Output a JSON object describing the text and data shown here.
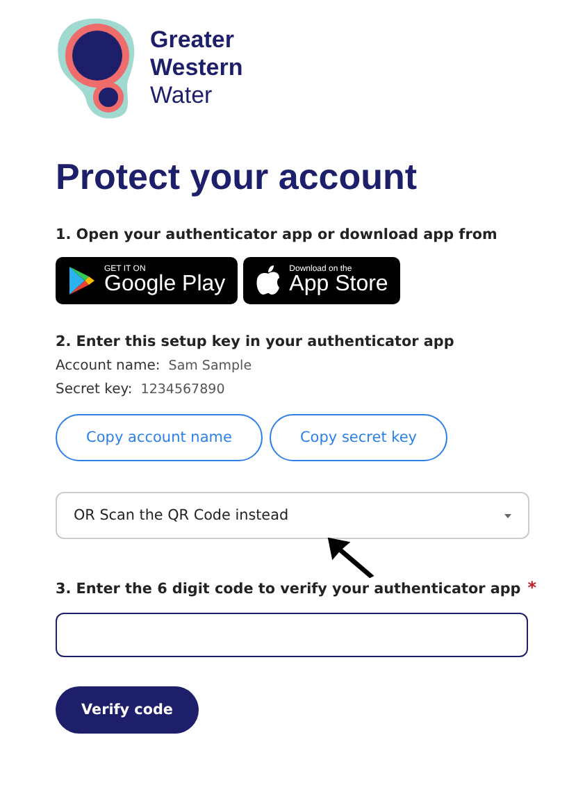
{
  "logo": {
    "line_1": "Greater",
    "line_2": "Western",
    "line_3": "Water"
  },
  "title": "Protect your account",
  "step_1": {
    "label": "1. Open your authenticator app or download app from",
    "store_badges": [
      {
        "kind": "google",
        "small": "GET IT ON",
        "big": "Google Play"
      },
      {
        "kind": "apple",
        "small": "Download on the",
        "big": "App Store"
      }
    ]
  },
  "step_2": {
    "label": "2. Enter this setup key in your authenticator app",
    "fields": [
      {
        "label": "Account name:",
        "value": "Sam Sample"
      },
      {
        "label": "Secret key:",
        "value": "1234567890"
      }
    ],
    "buttons": [
      "Copy account name",
      "Copy secret key"
    ]
  },
  "qr_dropdown": {
    "label": "OR Scan the QR Code instead",
    "expanded": false
  },
  "step_3": {
    "label": "3. Enter the 6 digit code to verify your authenticator app",
    "required_mark": "*"
  },
  "submit_button": "Verify code"
}
